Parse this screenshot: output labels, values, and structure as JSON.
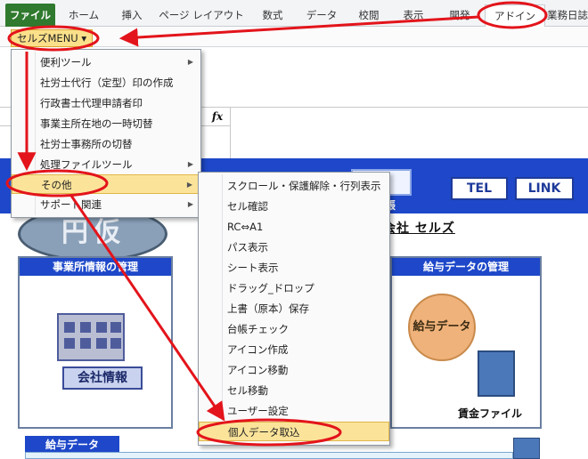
{
  "ribbon": {
    "tabs": [
      "ファイル",
      "ホーム",
      "挿入",
      "ページ レイアウト",
      "数式",
      "データ",
      "校閲",
      "表示",
      "開発",
      "アドイン",
      "業務日誌"
    ]
  },
  "addin": {
    "menu_button": "セルズMENU ▾"
  },
  "formula_bar": {
    "fx": "fx"
  },
  "menu1": {
    "items": [
      {
        "label": "便利ツール",
        "submenu": true
      },
      {
        "label": "社労士代行（定型）印の作成",
        "submenu": false
      },
      {
        "label": "行政書士代理申請者印",
        "submenu": false
      },
      {
        "label": "事業主所在地の一時切替",
        "submenu": false
      },
      {
        "label": "社労士事務所の切替",
        "submenu": false
      },
      {
        "label": "処理ファイルツール",
        "submenu": true
      },
      {
        "label": "その他",
        "submenu": true
      },
      {
        "label": "サポート関連",
        "submenu": true
      }
    ]
  },
  "menu2": {
    "items": [
      "スクロール・保護解除・行列表示",
      "セル確認",
      "RC⇔A1",
      "パス表示",
      "シート表示",
      "ドラッグ_ドロップ",
      "上書（原本）保存",
      "台帳チェック",
      "アイコン作成",
      "アイコン移動",
      "セル移動",
      "ユーザー設定",
      "個人データ取込"
    ]
  },
  "banner": {
    "arrow_symbol": "⇒",
    "tel_button": "TEL",
    "link_button": "LINK",
    "small_text": "帳",
    "company_name": "会社 セルズ",
    "logo_text": "円仮"
  },
  "panels": {
    "left_title": "事業所情報の管理",
    "left_button": "会社情報",
    "right_title": "給与データの管理",
    "right_circle": "給与データ",
    "right_file": "賃金ファイル",
    "bottom_tab": "給与データ"
  },
  "colors": {
    "annotation_red": "#e3141b",
    "banner_blue": "#1e48c9",
    "highlight": "#fbe49a"
  }
}
